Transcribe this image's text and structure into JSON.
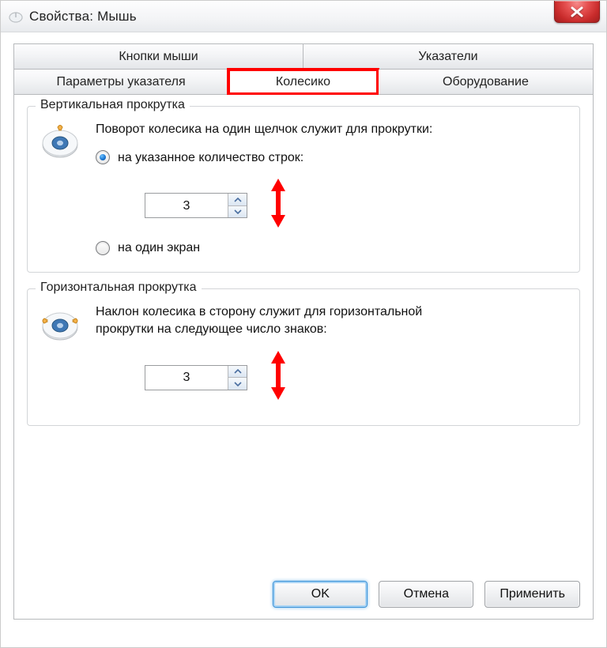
{
  "window": {
    "title": "Свойства: Мышь"
  },
  "tabs": {
    "row1": [
      "Кнопки мыши",
      "Указатели"
    ],
    "row2": [
      "Параметры указателя",
      "Колесико",
      "Оборудование"
    ],
    "selected": "Колесико"
  },
  "vertical": {
    "legend": "Вертикальная прокрутка",
    "desc": "Поворот колесика на один щелчок служит для прокрутки:",
    "opt_lines": "на указанное количество строк:",
    "lines_value": "3",
    "opt_screen": "на один экран"
  },
  "horizontal": {
    "legend": "Горизонтальная прокрутка",
    "desc": "Наклон колесика в сторону служит для горизонтальной прокрутки на следующее число знаков:",
    "chars_value": "3"
  },
  "buttons": {
    "ok": "OK",
    "cancel": "Отмена",
    "apply": "Применить"
  }
}
